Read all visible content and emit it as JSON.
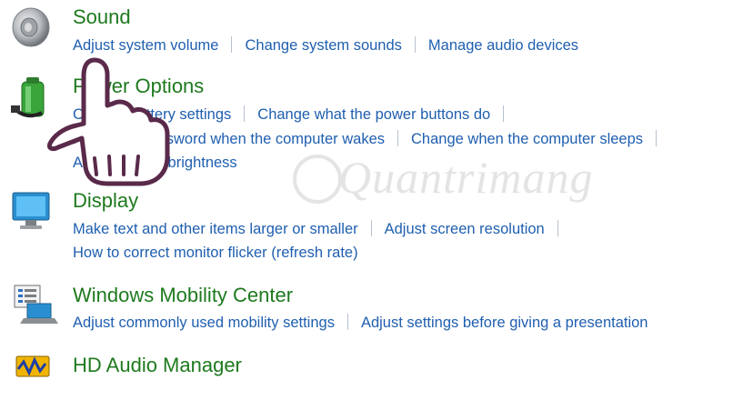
{
  "sections": [
    {
      "title": "Sound",
      "icon": "speaker-icon",
      "links": [
        "Adjust system volume",
        "Change system sounds",
        "Manage audio devices"
      ]
    },
    {
      "title": "Power Options",
      "icon": "battery-icon",
      "links": [
        "Change battery settings",
        "Change what the power buttons do",
        "Require a password when the computer wakes",
        "Change when the computer sleeps",
        "Adjust screen brightness"
      ]
    },
    {
      "title": "Display",
      "icon": "monitor-icon",
      "links": [
        "Make text and other items larger or smaller",
        "Adjust screen resolution",
        "How to correct monitor flicker (refresh rate)"
      ]
    },
    {
      "title": "Windows Mobility Center",
      "icon": "mobility-center-icon",
      "links": [
        "Adjust commonly used mobility settings",
        "Adjust settings before giving a presentation"
      ]
    },
    {
      "title": "HD Audio Manager",
      "icon": "audio-manager-icon",
      "links": []
    }
  ],
  "watermark": "Quantrimang",
  "colors": {
    "title": "#1e7a1e",
    "link": "#1f5fb0",
    "separator": "#b8c2cc"
  }
}
